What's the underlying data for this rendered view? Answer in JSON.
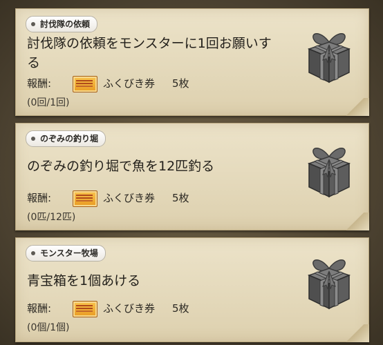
{
  "quests": [
    {
      "tag": "討伐隊の依頼",
      "title_line1": "討伐隊の依頼をモンスターに1回お願いす",
      "title_line2": "る",
      "reward_label": "報酬:",
      "reward_item": "ふくびき券",
      "reward_count": "5枚",
      "progress": "(0回/1回)",
      "icon": "gift-box-icon"
    },
    {
      "tag": "のぞみの釣り堀",
      "title_line1": "のぞみの釣り堀で魚を12匹釣る",
      "title_line2": "",
      "reward_label": "報酬:",
      "reward_item": "ふくびき券",
      "reward_count": "5枚",
      "progress": "(0匹/12匹)",
      "icon": "gift-box-icon"
    },
    {
      "tag": "モンスター牧場",
      "title_line1": "青宝箱を1個あける",
      "title_line2": "",
      "reward_label": "報酬:",
      "reward_item": "ふくびき券",
      "reward_count": "5枚",
      "progress": "(0個/1個)",
      "icon": "gift-box-icon"
    }
  ],
  "colors": {
    "card_bg": "#e4d9bb",
    "frame_bg": "#4b4130",
    "ticket": "#f0a830",
    "gift": "#5a5a5a"
  }
}
